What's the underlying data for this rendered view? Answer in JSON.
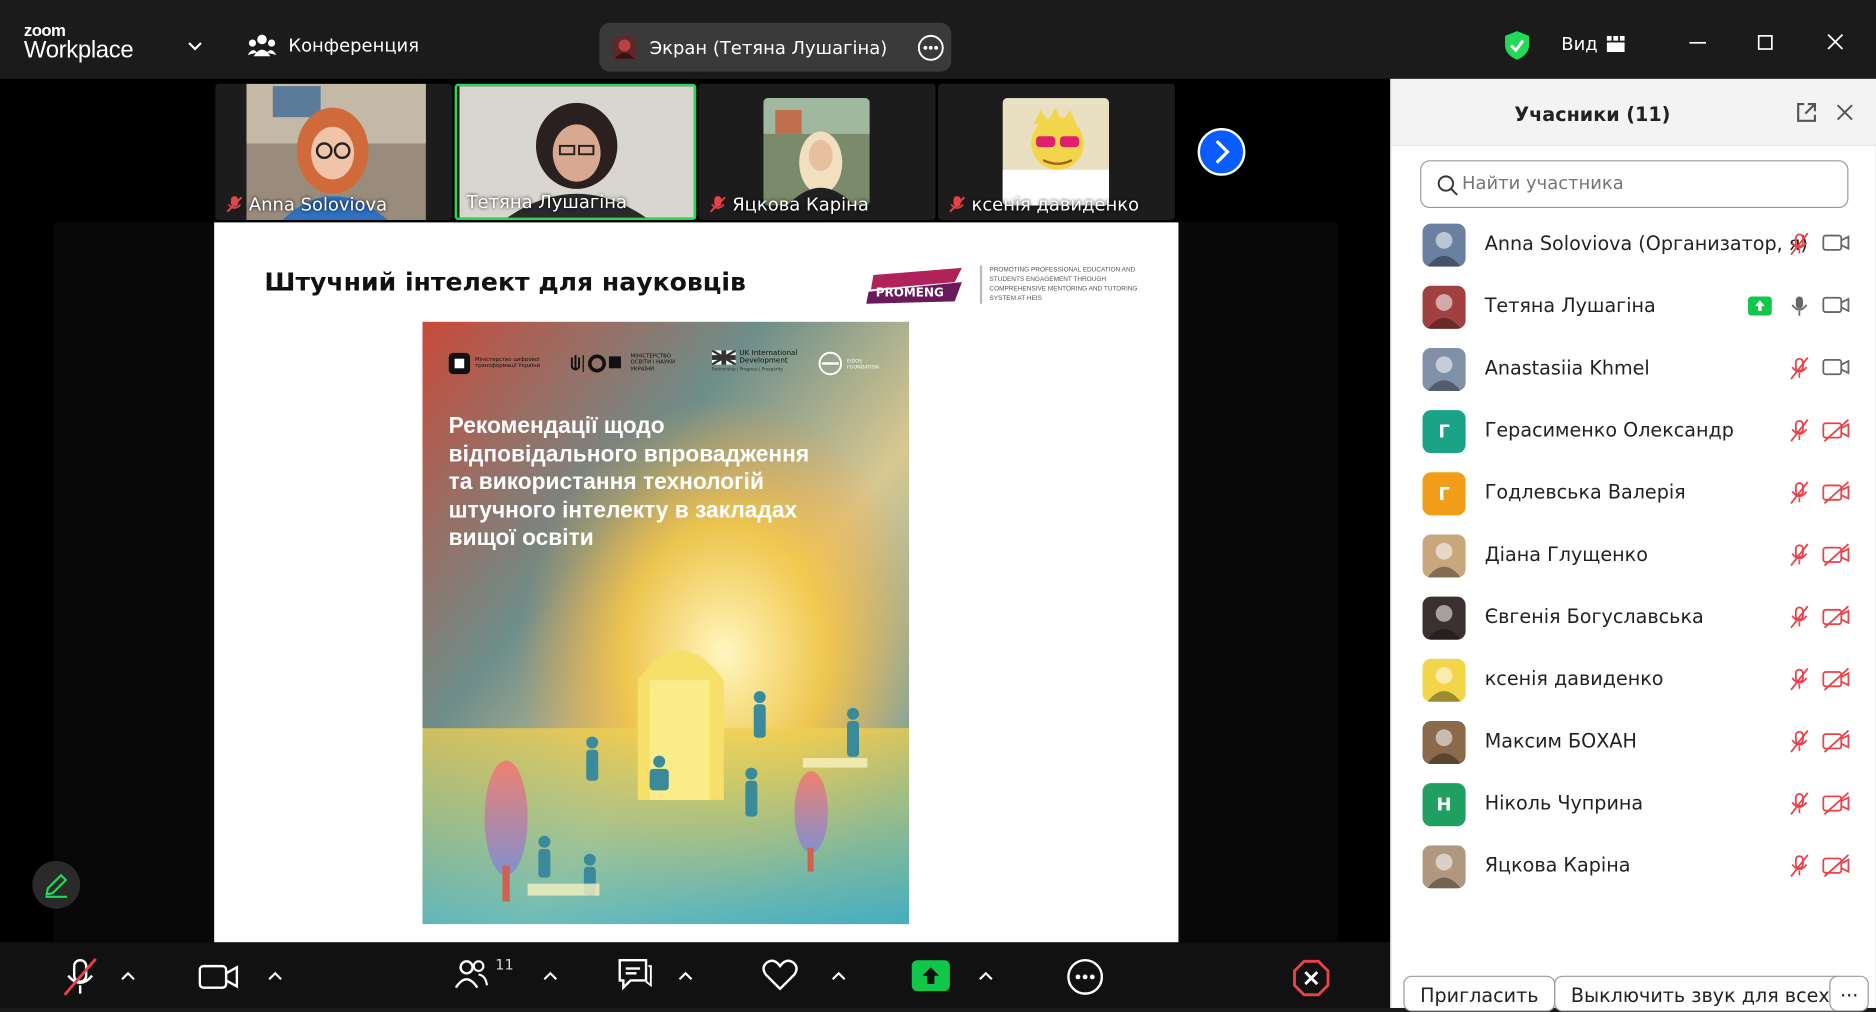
{
  "app": {
    "logo_top": "zoom",
    "logo_bottom": "Workplace"
  },
  "titlebar": {
    "meeting_label": "Конференция",
    "share_label": "Экран (Тетяна Лушагіна)",
    "view_label": "Вид"
  },
  "gallery": [
    {
      "name": "Anna Soloviova",
      "muted": true,
      "active": false,
      "bg": "#9a8c7c"
    },
    {
      "name": "Тетяна Лушагіна",
      "muted": false,
      "active": true,
      "bg": "#d8d6cf"
    },
    {
      "name": "Яцкова Каріна",
      "muted": true,
      "active": false,
      "bg": "#7a8a6a"
    },
    {
      "name": "ксенія давиденко",
      "muted": true,
      "active": false,
      "bg": "#e8e0c0"
    }
  ],
  "slide": {
    "heading": "Штучний інтелект для науковців",
    "promeng_logo": "PROMENG",
    "promeng_tagline": "PROMOTING PROFESSIONAL EDUCATION AND STUDENTS ENGAGEMENT THROUGH COMPREHENSIVE MENTORING AND TUTORING SYSTEM AT HEIS",
    "cover_logo_ministry_digital": "Міністерство цифрової трансформації України",
    "cover_logo_ministry_education": "МІНІСТЕРСТВО ОСВІТИ І НАУКИ УКРАЇНИ",
    "cover_logo_uk": "UK International Development",
    "cover_logo_uk_sub": "Partnership | Progress | Prosperity",
    "cover_logo_eidos": "EIDOS FOUNDATION",
    "cover_title_lines": [
      "Рекомендації щодо",
      "відповідального впровадження",
      "та використання технологій",
      "штучного інтелекту в закладах",
      "вищої освіти"
    ]
  },
  "panel": {
    "title": "Учасники (11)",
    "search_placeholder": "Найти участника",
    "participants": [
      {
        "name": "Anna Soloviova (Организатор, я)",
        "avatar_letter": "",
        "avatar_color": "#6b7fa0",
        "mic_muted": true,
        "video_off": false,
        "sharing": false
      },
      {
        "name": "Тетяна Лушагіна",
        "avatar_letter": "",
        "avatar_color": "#a04040",
        "mic_muted": false,
        "video_off": false,
        "sharing": true
      },
      {
        "name": "Anastasiia Khmel",
        "avatar_letter": "",
        "avatar_color": "#8090a8",
        "mic_muted": true,
        "video_off": false,
        "sharing": false
      },
      {
        "name": "Герасименко Олександр",
        "avatar_letter": "Г",
        "avatar_color": "#1aa384",
        "mic_muted": true,
        "video_off": true,
        "sharing": false
      },
      {
        "name": "Годлевська Валерія",
        "avatar_letter": "Г",
        "avatar_color": "#f29d17",
        "mic_muted": true,
        "video_off": true,
        "sharing": false
      },
      {
        "name": "Діана Глущенко",
        "avatar_letter": "",
        "avatar_color": "#c9a77c",
        "mic_muted": true,
        "video_off": true,
        "sharing": false
      },
      {
        "name": "Євгенія Богуславська",
        "avatar_letter": "",
        "avatar_color": "#3a3030",
        "mic_muted": true,
        "video_off": true,
        "sharing": false
      },
      {
        "name": "ксенія давиденко",
        "avatar_letter": "",
        "avatar_color": "#f3d54a",
        "mic_muted": true,
        "video_off": true,
        "sharing": false
      },
      {
        "name": "Максим БОХАН",
        "avatar_letter": "",
        "avatar_color": "#8a6a4a",
        "mic_muted": true,
        "video_off": true,
        "sharing": false
      },
      {
        "name": "Ніколь Чуприна",
        "avatar_letter": "Н",
        "avatar_color": "#20a060",
        "mic_muted": true,
        "video_off": true,
        "sharing": false
      },
      {
        "name": "Яцкова Каріна",
        "avatar_letter": "",
        "avatar_color": "#b09880",
        "mic_muted": true,
        "video_off": true,
        "sharing": false
      }
    ],
    "invite_label": "Пригласить",
    "mute_all_label": "Выключить звук для всех",
    "more_label": "···"
  },
  "toolbar": {
    "participants_count": "11"
  },
  "colors": {
    "accent_green": "#23d959",
    "zoom_blue": "#0b5cff",
    "mute_red": "#e8424a",
    "share_green": "#10c74a"
  }
}
